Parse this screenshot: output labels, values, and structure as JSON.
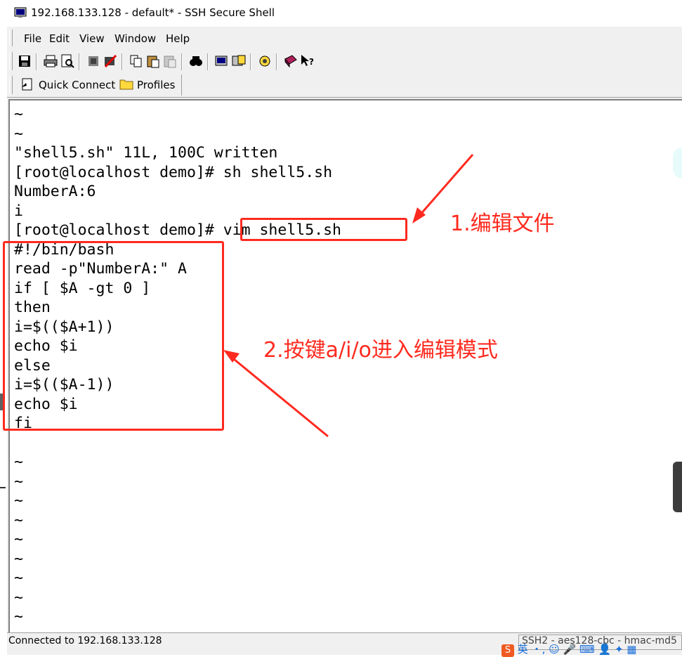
{
  "window": {
    "title": "192.168.133.128 - default* - SSH Secure Shell"
  },
  "menu": {
    "file": "File",
    "edit": "Edit",
    "view": "View",
    "window": "Window",
    "help": "Help"
  },
  "toolbar": {
    "icons": [
      "save-icon",
      "print-icon",
      "print-preview-icon",
      "tunnel-icon",
      "disconnect-icon",
      "copy-icon",
      "paste-icon",
      "paste-disabled-icon",
      "find-icon",
      "settings-icon",
      "new-file-transfer-icon",
      "sftp-icon",
      "help-book-icon",
      "context-help-icon"
    ]
  },
  "quickbar": {
    "quick_connect": "Quick Connect",
    "profiles": "Profiles"
  },
  "terminal": {
    "lines": [
      "~",
      "~",
      "\"shell5.sh\" 11L, 100C written",
      "[root@localhost demo]# sh shell5.sh",
      "NumberA:6",
      "i",
      "[root@localhost demo]# vim shell5.sh",
      "#!/bin/bash",
      "read -p\"NumberA:\" A",
      "if [ $A -gt 0 ]",
      "then",
      "i=$(($A+1))",
      "echo $i",
      "else",
      "i=$(($A-1))",
      "echo $i",
      "fi",
      "",
      "~",
      "~",
      "~",
      "~",
      "~",
      "~",
      "~",
      "~",
      "~"
    ]
  },
  "status": {
    "connection": "Connected to 192.168.133.128",
    "cipher": "SSH2 - aes128-cbc - hmac-md5"
  },
  "annotations": {
    "step1": "1.编辑文件",
    "step2": "2.按键a/i/o进入编辑模式",
    "color": "#ff2a1f"
  },
  "ime": {
    "logo": "S",
    "lang": "英"
  }
}
